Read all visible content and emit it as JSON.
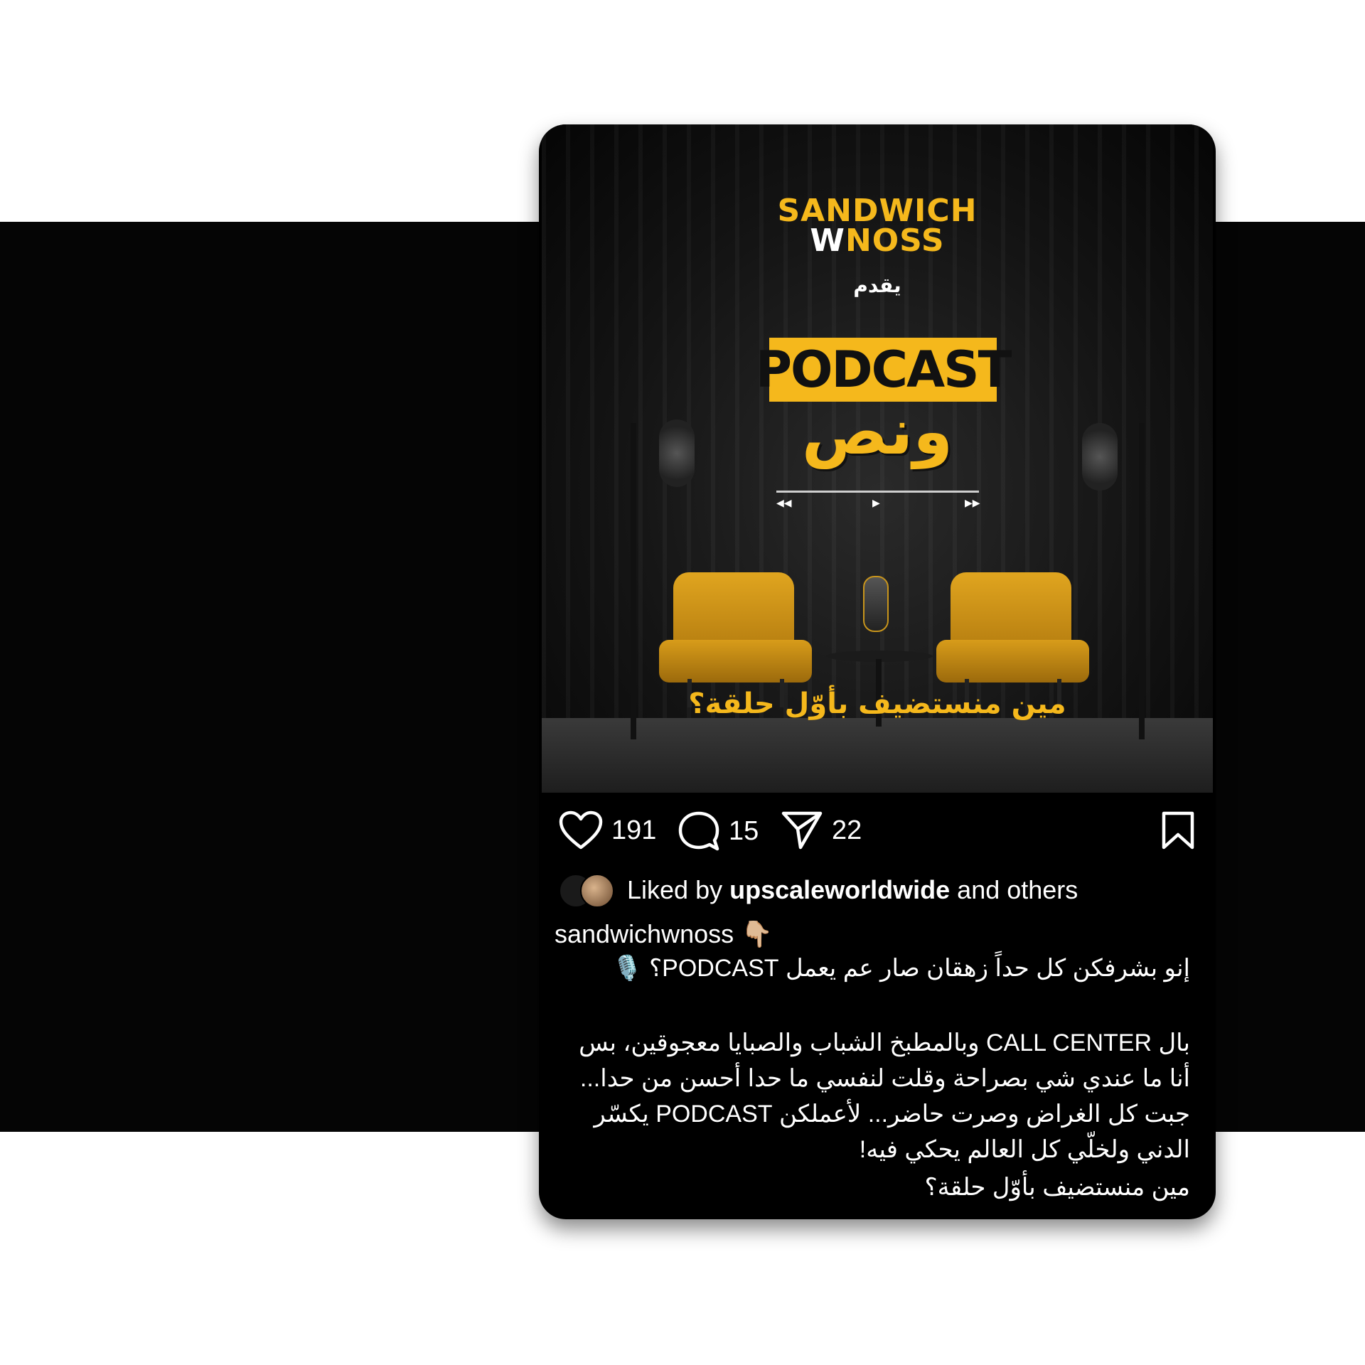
{
  "brand": {
    "line1": "SANDWICH",
    "line2_w": "W",
    "line2_noss": "NOSS"
  },
  "poster": {
    "presents": "يقدم",
    "podcast_label": "PODCAST",
    "wanos": "ونص",
    "question": "مين منستضيف بأوّل حلقة؟"
  },
  "actions": {
    "likes": "191",
    "comments": "15",
    "shares": "22"
  },
  "liked_by": {
    "prefix": "Liked by ",
    "user": "upscaleworldwide",
    "suffix": " and others"
  },
  "post": {
    "username": "sandwichwnoss 👇🏼",
    "caption_lines": [
      "إنو بشرفكن كل حداً زهقان صار عم يعمل PODCAST؟ 🎙️",
      "بال CALL CENTER وبالمطبخ الشباب والصبايا معجوقين، بس",
      "أنا ما عندي شي بصراحة وقلت لنفسي ما حدا أحسن من حدا...",
      "جبت كل الغراض وصرت حاضر... لأعملكن PODCAST يكسّر",
      "الدني ولخلّي كل العالم يحكي فيه!",
      "مين منستضيف بأوّل حلقة؟"
    ]
  },
  "colors": {
    "accent": "#f5b81c",
    "card_bg": "#000000",
    "band_bg": "#050505",
    "page_bg": "#ffffff"
  },
  "icons": [
    "heart-icon",
    "comment-icon",
    "share-icon",
    "bookmark-icon"
  ]
}
